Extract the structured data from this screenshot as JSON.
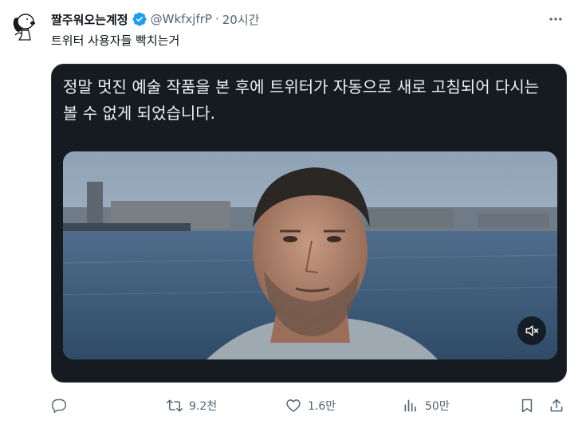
{
  "tweet": {
    "display_name": "짤주워오는계정",
    "handle": "@WkfxjfrP",
    "separator": "·",
    "time": "20시간",
    "text": "트위터 사용자들 빡치는거",
    "verified_icon": "verified-badge-icon",
    "verified_color": "#1d9bf0"
  },
  "card": {
    "caption": "정말 멋진 예술 작품을 본 후에 트위터가 자동으로 새로 고침되어 다시는 볼 수 없게 되었습니다.",
    "background": "#151b21",
    "media": "video-still-man-by-water",
    "mute_icon": "volume-muted-icon"
  },
  "actions": {
    "reply": {
      "icon": "reply-icon",
      "count": ""
    },
    "retweet": {
      "icon": "retweet-icon",
      "count": "9.2천"
    },
    "like": {
      "icon": "heart-icon",
      "count": "1.6만"
    },
    "views": {
      "icon": "analytics-icon",
      "count": "50만"
    },
    "bookmark": {
      "icon": "bookmark-icon"
    },
    "share": {
      "icon": "share-icon"
    }
  },
  "colors": {
    "text_primary": "#0f1419",
    "text_secondary": "#536471",
    "accent": "#1d9bf0"
  }
}
